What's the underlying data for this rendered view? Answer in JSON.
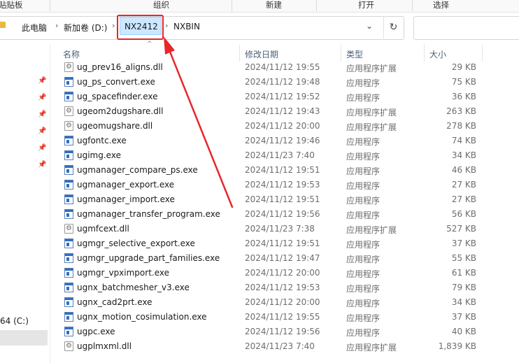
{
  "ribbon": {
    "groups": [
      "贴贴板",
      "组织",
      "新建",
      "打开",
      "选择"
    ]
  },
  "address": {
    "crumbs": [
      "此电脑",
      "新加卷 (D:)",
      "NX2412",
      "NXBIN"
    ],
    "separator_glyph": "›",
    "dropdown_glyph": "⌄",
    "refresh_glyph": "↻",
    "folder_icon": "folder-icon"
  },
  "nav": {
    "pin_glyph": "📌",
    "drive_label": "64 (C:)"
  },
  "columns": {
    "name": "名称",
    "date": "修改日期",
    "type": "类型",
    "size": "大小",
    "sort_glyph": "^"
  },
  "files": [
    {
      "name": "ug_prev16_aligns.dll",
      "date": "2024/11/12 19:55",
      "type": "应用程序扩展",
      "size": "29 KB",
      "icon": "dll"
    },
    {
      "name": "ug_ps_convert.exe",
      "date": "2024/11/12 19:48",
      "type": "应用程序",
      "size": "75 KB",
      "icon": "exe"
    },
    {
      "name": "ug_spacefinder.exe",
      "date": "2024/11/12 19:52",
      "type": "应用程序",
      "size": "36 KB",
      "icon": "exe"
    },
    {
      "name": "ugeom2dugshare.dll",
      "date": "2024/11/12 19:43",
      "type": "应用程序扩展",
      "size": "263 KB",
      "icon": "dll"
    },
    {
      "name": "ugeomugshare.dll",
      "date": "2024/11/12 20:00",
      "type": "应用程序扩展",
      "size": "278 KB",
      "icon": "dll"
    },
    {
      "name": "ugfontc.exe",
      "date": "2024/11/12 19:46",
      "type": "应用程序",
      "size": "74 KB",
      "icon": "exe"
    },
    {
      "name": "ugimg.exe",
      "date": "2024/11/23 7:40",
      "type": "应用程序",
      "size": "34 KB",
      "icon": "exe"
    },
    {
      "name": "ugmanager_compare_ps.exe",
      "date": "2024/11/12 19:51",
      "type": "应用程序",
      "size": "46 KB",
      "icon": "exe"
    },
    {
      "name": "ugmanager_export.exe",
      "date": "2024/11/12 19:53",
      "type": "应用程序",
      "size": "27 KB",
      "icon": "exe"
    },
    {
      "name": "ugmanager_import.exe",
      "date": "2024/11/12 19:51",
      "type": "应用程序",
      "size": "27 KB",
      "icon": "exe"
    },
    {
      "name": "ugmanager_transfer_program.exe",
      "date": "2024/11/12 19:56",
      "type": "应用程序",
      "size": "56 KB",
      "icon": "exe"
    },
    {
      "name": "ugmfcext.dll",
      "date": "2024/11/23 7:38",
      "type": "应用程序扩展",
      "size": "527 KB",
      "icon": "dll"
    },
    {
      "name": "ugmgr_selective_export.exe",
      "date": "2024/11/12 19:51",
      "type": "应用程序",
      "size": "37 KB",
      "icon": "exe"
    },
    {
      "name": "ugmgr_upgrade_part_families.exe",
      "date": "2024/11/12 19:47",
      "type": "应用程序",
      "size": "55 KB",
      "icon": "exe"
    },
    {
      "name": "ugmgr_vpximport.exe",
      "date": "2024/11/12 20:00",
      "type": "应用程序",
      "size": "61 KB",
      "icon": "exe"
    },
    {
      "name": "ugnx_batchmesher_v3.exe",
      "date": "2024/11/12 19:53",
      "type": "应用程序",
      "size": "79 KB",
      "icon": "exe"
    },
    {
      "name": "ugnx_cad2prt.exe",
      "date": "2024/11/12 20:00",
      "type": "应用程序",
      "size": "34 KB",
      "icon": "exe"
    },
    {
      "name": "ugnx_motion_cosimulation.exe",
      "date": "2024/11/12 19:55",
      "type": "应用程序",
      "size": "37 KB",
      "icon": "exe"
    },
    {
      "name": "ugpc.exe",
      "date": "2024/11/12 19:56",
      "type": "应用程序",
      "size": "40 KB",
      "icon": "exe"
    },
    {
      "name": "ugplmxml.dll",
      "date": "2024/11/23 7:40",
      "type": "应用程序扩展",
      "size": "1,839 KB",
      "icon": "dll"
    }
  ],
  "colors": {
    "annotation_red": "#e8262a",
    "selection_blue": "#cce8ff"
  }
}
